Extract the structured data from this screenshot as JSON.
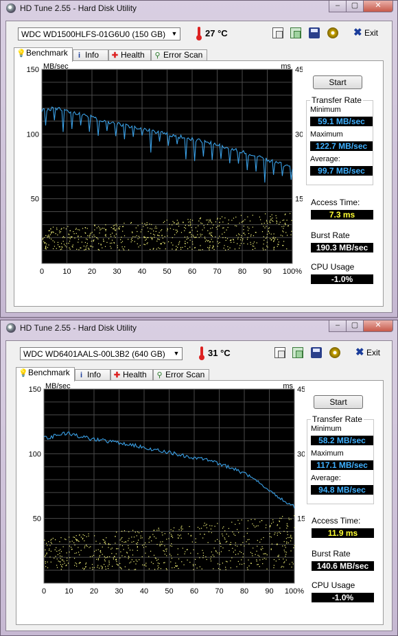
{
  "windows": [
    {
      "title": "HD Tune 2.55 - Hard Disk Utility",
      "drive": "WDC WD1500HLFS-01G6U0 (150 GB)",
      "temperature": "27 °C",
      "exit_label": "Exit",
      "tabs": [
        "Benchmark",
        "Info",
        "Health",
        "Error Scan"
      ],
      "start_label": "Start",
      "transfer_rate_title": "Transfer Rate",
      "minimum_label": "Minimum",
      "minimum_value": "59.1 MB/sec",
      "maximum_label": "Maximum",
      "maximum_value": "122.7 MB/sec",
      "average_label": "Average:",
      "average_value": "99.7 MB/sec",
      "access_time_label": "Access Time:",
      "access_time_value": "7.3 ms",
      "burst_rate_label": "Burst Rate",
      "burst_rate_value": "190.3 MB/sec",
      "cpu_usage_label": "CPU Usage",
      "cpu_usage_value": "-1.0%"
    },
    {
      "title": "HD Tune 2.55 - Hard Disk Utility",
      "drive": "WDC WD6401AALS-00L3B2 (640 GB)",
      "temperature": "31 °C",
      "exit_label": "Exit",
      "tabs": [
        "Benchmark",
        "Info",
        "Health",
        "Error Scan"
      ],
      "start_label": "Start",
      "transfer_rate_title": "Transfer Rate",
      "minimum_label": "Minimum",
      "minimum_value": "58.2 MB/sec",
      "maximum_label": "Maximum",
      "maximum_value": "117.1 MB/sec",
      "average_label": "Average:",
      "average_value": "94.8 MB/sec",
      "access_time_label": "Access Time:",
      "access_time_value": "11.9 ms",
      "burst_rate_label": "Burst Rate",
      "burst_rate_value": "140.6 MB/sec",
      "cpu_usage_label": "CPU Usage",
      "cpu_usage_value": "-1.0%"
    }
  ],
  "colors": {
    "chart_bg": "#000000",
    "grid": "#4a4a4a",
    "transfer_line": "#3aa0e6",
    "access_dots": "#ffff80",
    "value_blue": "#3fb0ff",
    "value_yellow": "#ffff33"
  },
  "icons": [
    "thermometer-icon",
    "copy-text-icon",
    "copy-image-icon",
    "save-icon",
    "options-icon",
    "exit-icon",
    "benchmark-icon",
    "info-icon",
    "health-icon",
    "error-scan-icon"
  ],
  "chart_data": [
    {
      "type": "line",
      "ylabel": "MB/sec",
      "y2label": "ms",
      "ylim": [
        0,
        150
      ],
      "y2lim": [
        0,
        45
      ],
      "yticks": [
        150,
        100,
        50
      ],
      "y2ticks": [
        45,
        30,
        15
      ],
      "xlim": [
        0,
        100
      ],
      "xticks": [
        "0",
        "10",
        "20",
        "30",
        "40",
        "50",
        "60",
        "70",
        "80",
        "90",
        "100%"
      ],
      "grid": true,
      "series": [
        {
          "x": [
            0,
            5,
            10,
            15,
            20,
            25,
            30,
            35,
            40,
            45,
            50,
            55,
            60,
            65,
            70,
            75,
            80,
            85,
            90,
            95,
            100
          ],
          "y": [
            118,
            120,
            118,
            116,
            113,
            110,
            108,
            106,
            104,
            102,
            100,
            98,
            96,
            94,
            92,
            89,
            86,
            83,
            80,
            77,
            74
          ]
        }
      ],
      "scatter_band_ms": [
        4,
        12
      ]
    },
    {
      "type": "line",
      "ylabel": "MB/sec",
      "y2label": "ms",
      "ylim": [
        0,
        150
      ],
      "y2lim": [
        0,
        45
      ],
      "yticks": [
        150,
        100,
        50
      ],
      "y2ticks": [
        45,
        30,
        15
      ],
      "xlim": [
        0,
        100
      ],
      "xticks": [
        "0",
        "10",
        "20",
        "30",
        "40",
        "50",
        "60",
        "70",
        "80",
        "90",
        "100%"
      ],
      "grid": true,
      "series": [
        {
          "x": [
            0,
            5,
            10,
            15,
            20,
            25,
            30,
            35,
            40,
            45,
            50,
            55,
            60,
            65,
            70,
            75,
            80,
            85,
            90,
            95,
            100
          ],
          "y": [
            112,
            114,
            116,
            113,
            111,
            110,
            108,
            107,
            105,
            103,
            101,
            99,
            97,
            95,
            92,
            89,
            85,
            80,
            72,
            65,
            59
          ]
        }
      ],
      "scatter_band_ms": [
        4,
        16
      ]
    }
  ]
}
